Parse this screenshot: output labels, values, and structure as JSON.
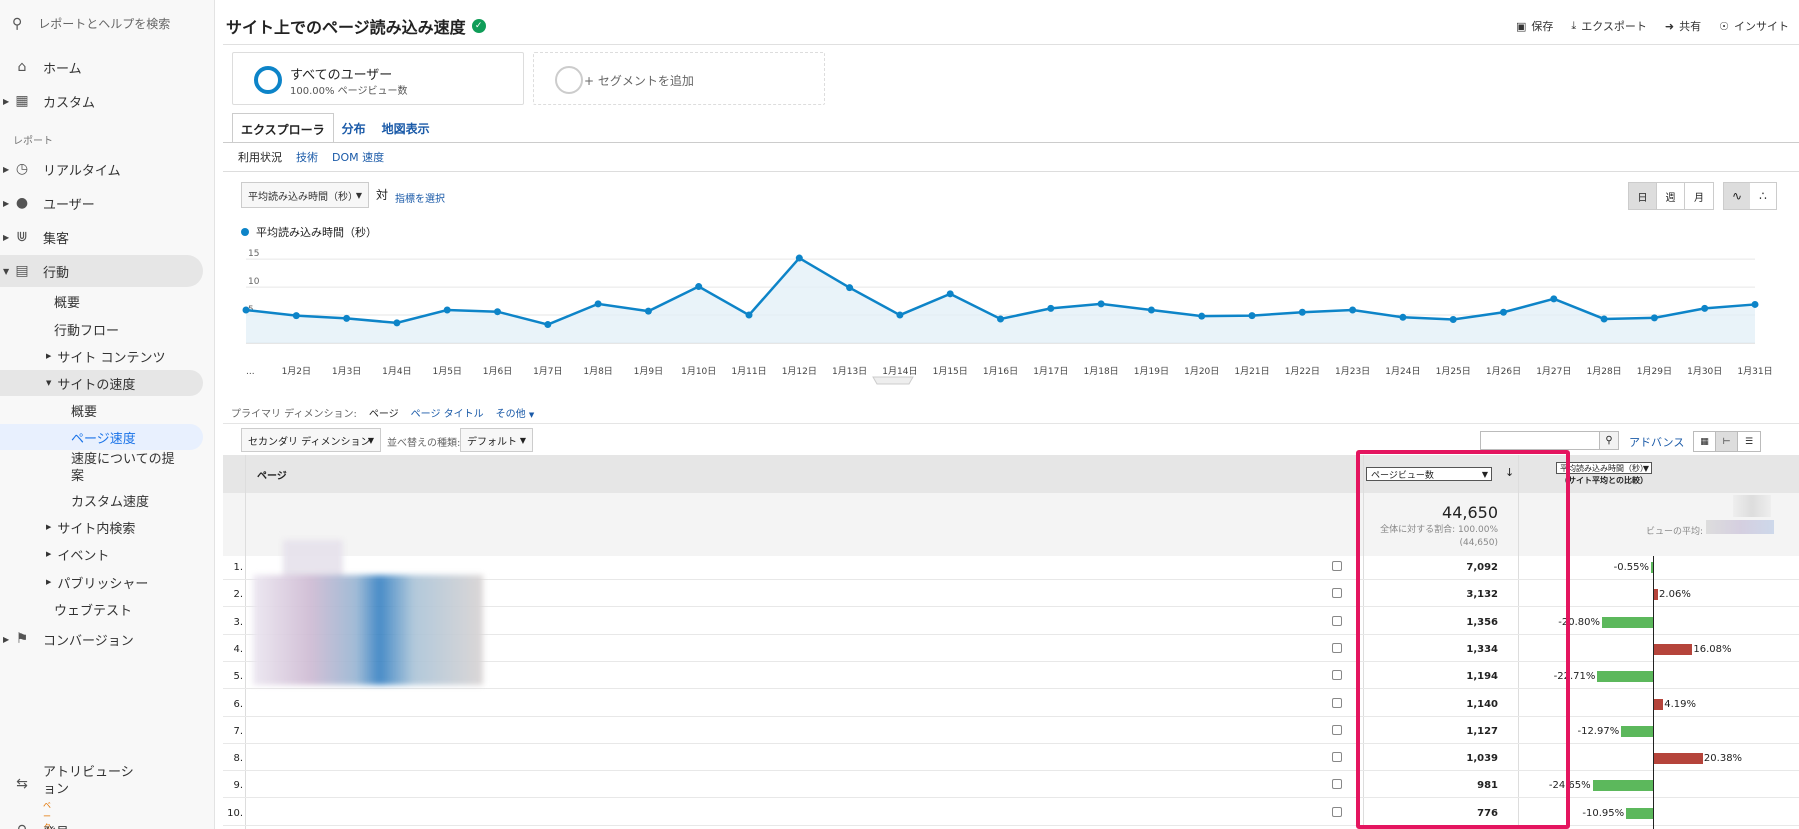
{
  "sidebar": {
    "search_placeholder": "レポートとヘルプを検索",
    "home": "ホーム",
    "custom": "カスタム",
    "reports_section": "レポート",
    "realtime": "リアルタイム",
    "users": "ユーザー",
    "acquisition": "集客",
    "behavior": "行動",
    "behavior_overview": "概要",
    "behavior_flow": "行動フロー",
    "site_content": "サイト コンテンツ",
    "site_speed": "サイトの速度",
    "speed_overview": "概要",
    "page_timings": "ページ速度",
    "speed_suggestions": "速度についての提案",
    "custom_speed": "カスタム速度",
    "site_search": "サイト内検索",
    "events": "イベント",
    "publisher": "パブリッシャー",
    "experiments": "ウェブテスト",
    "conversions": "コンバージョン",
    "attribution": "アトリビューション",
    "attribution_badge": "ベータ版",
    "discover": "発見"
  },
  "header": {
    "title": "サイト上でのページ読み込み速度",
    "save": "保存",
    "export": "エクスポート",
    "share": "共有",
    "insights": "インサイト"
  },
  "segments": {
    "all_users": "すべてのユーザー",
    "all_users_sub": "100.00% ページビュー数",
    "add_segment": "+ セグメントを追加"
  },
  "tabs": [
    "エクスプローラ",
    "分布",
    "地図表示"
  ],
  "subtabs": [
    "利用状況",
    "技術",
    "DOM 速度"
  ],
  "chart_controls": {
    "metric": "平均読み込み時間（秒）",
    "vs": "対",
    "select_metric": "指標を選択",
    "period_buttons": [
      "日",
      "週",
      "月"
    ]
  },
  "chart_data": {
    "type": "line",
    "series": [
      {
        "name": "平均読み込み時間（秒）",
        "values": [
          5.9,
          4.9,
          4.4,
          3.6,
          5.9,
          5.6,
          3.3,
          7.0,
          5.7,
          10.1,
          5.0,
          15.2,
          9.9,
          5.0,
          8.8,
          4.3,
          6.2,
          7.0,
          5.9,
          4.8,
          4.9,
          5.5,
          5.9,
          4.6,
          4.2,
          5.5,
          7.9,
          4.3,
          4.5,
          6.2,
          6.9
        ]
      }
    ],
    "x": [
      "...",
      "1月2日",
      "1月3日",
      "1月4日",
      "1月5日",
      "1月6日",
      "1月7日",
      "1月8日",
      "1月9日",
      "1月10日",
      "1月11日",
      "1月12日",
      "1月13日",
      "1月14日",
      "1月15日",
      "1月16日",
      "1月17日",
      "1月18日",
      "1月19日",
      "1月20日",
      "1月21日",
      "1月22日",
      "1月23日",
      "1月24日",
      "1月25日",
      "1月26日",
      "1月27日",
      "1月28日",
      "1月29日",
      "1月30日",
      "1月31日"
    ],
    "y_ticks": [
      "15",
      "10",
      "5"
    ],
    "ylim": [
      0,
      17
    ],
    "colors": {
      "line": "#0d84c8",
      "fill": "#e3f0f8"
    }
  },
  "table_controls": {
    "primary_dimension_label": "プライマリ ディメンション:",
    "primary_dimension": "ページ",
    "page_title": "ページ タイトル",
    "other": "その他",
    "secondary_dimension": "セカンダリ ディメンション",
    "sort_type_label": "並べ替えの種類:",
    "sort_type": "デフォルト",
    "advanced": "アドバンス"
  },
  "table": {
    "col_page": "ページ",
    "col_pageviews": "ページビュー数",
    "col_compare_1": "平均読み込み時間（秒）",
    "col_compare_2": "（サイト平均との比較）",
    "total_pageviews": "44,650",
    "total_sub_1": "全体に対する割合: 100.00%",
    "total_sub_2": "(44,650)",
    "view_avg_label": "ビューの平均:",
    "rows": [
      {
        "num": "1.",
        "pageviews": "7,092",
        "pct": "-0.55%",
        "delta": -0.55
      },
      {
        "num": "2.",
        "pageviews": "3,132",
        "pct": "2.06%",
        "delta": 2.06
      },
      {
        "num": "3.",
        "pageviews": "1,356",
        "pct": "-20.80%",
        "delta": -20.8
      },
      {
        "num": "4.",
        "pageviews": "1,334",
        "pct": "16.08%",
        "delta": 16.08
      },
      {
        "num": "5.",
        "pageviews": "1,194",
        "pct": "-22.71%",
        "delta": -22.71
      },
      {
        "num": "6.",
        "pageviews": "1,140",
        "pct": "4.19%",
        "delta": 4.19
      },
      {
        "num": "7.",
        "pageviews": "1,127",
        "pct": "-12.97%",
        "delta": -12.97
      },
      {
        "num": "8.",
        "pageviews": "1,039",
        "pct": "20.38%",
        "delta": 20.38
      },
      {
        "num": "9.",
        "pageviews": "981",
        "pct": "-24.65%",
        "delta": -24.65
      },
      {
        "num": "10.",
        "pageviews": "776",
        "pct": "-10.95%",
        "delta": -10.95
      }
    ],
    "colors": {
      "positive": "#b5443b",
      "negative": "#5cb85c",
      "highlight": "#e4155f"
    }
  }
}
